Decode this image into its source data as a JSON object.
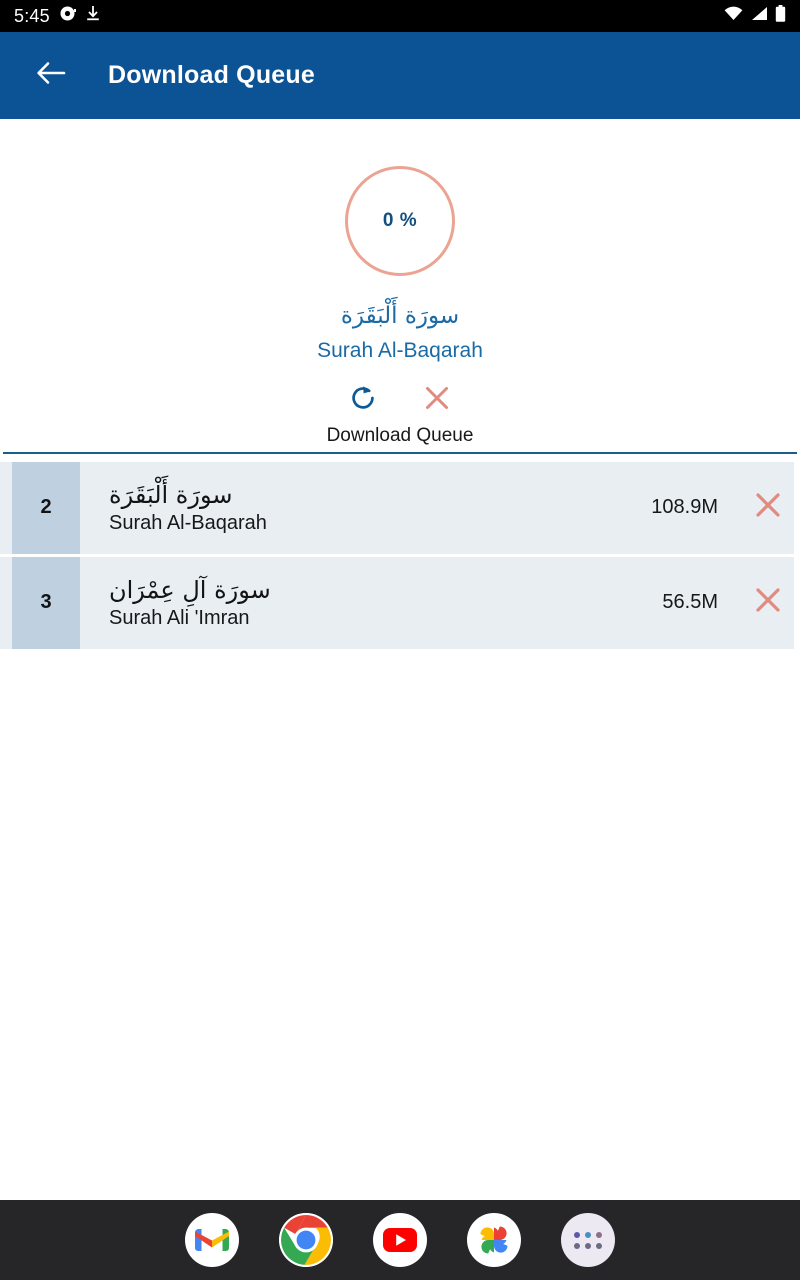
{
  "status_bar": {
    "clock": "5:45",
    "icons_left": [
      "record-icon",
      "download-icon"
    ],
    "icons_right": [
      "wifi-icon",
      "cellular-signal-icon",
      "battery-icon"
    ]
  },
  "app_bar": {
    "back_icon": "back-arrow-icon",
    "title": "Download Queue",
    "background": "#0b5394"
  },
  "progress": {
    "percent_label": "0 %",
    "percent_value": 0,
    "ring_color": "#eba493",
    "text_color": "#13507f",
    "current_arabic": "سورَة أَلْبَقَرَة",
    "current_latin": "Surah Al-Baqarah",
    "actions": [
      {
        "name": "refresh-button",
        "icon": "refresh-icon",
        "color": "#0d5a96"
      },
      {
        "name": "cancel-button",
        "icon": "close-x-icon",
        "color": "#e08a80"
      }
    ]
  },
  "section": {
    "label": "Download Queue",
    "divider_color": "#1a5f8a"
  },
  "queue": {
    "rows": [
      {
        "index": "2",
        "arabic": "سورَة أَلْبَقَرَة",
        "latin": "Surah Al-Baqarah",
        "size": "108.9M",
        "cancel_icon": "close-x-icon"
      },
      {
        "index": "3",
        "arabic": "سورَة آلِ عِمْرَان",
        "latin": "Surah Ali 'Imran",
        "size": "56.5M",
        "cancel_icon": "close-x-icon"
      }
    ]
  },
  "dock": {
    "background": "#262628",
    "items": [
      {
        "name": "gmail-icon",
        "label": "Gmail"
      },
      {
        "name": "chrome-icon",
        "label": "Chrome"
      },
      {
        "name": "youtube-icon",
        "label": "YouTube"
      },
      {
        "name": "google-photos-icon",
        "label": "Photos"
      },
      {
        "name": "app-drawer-icon",
        "label": "All apps"
      }
    ]
  }
}
